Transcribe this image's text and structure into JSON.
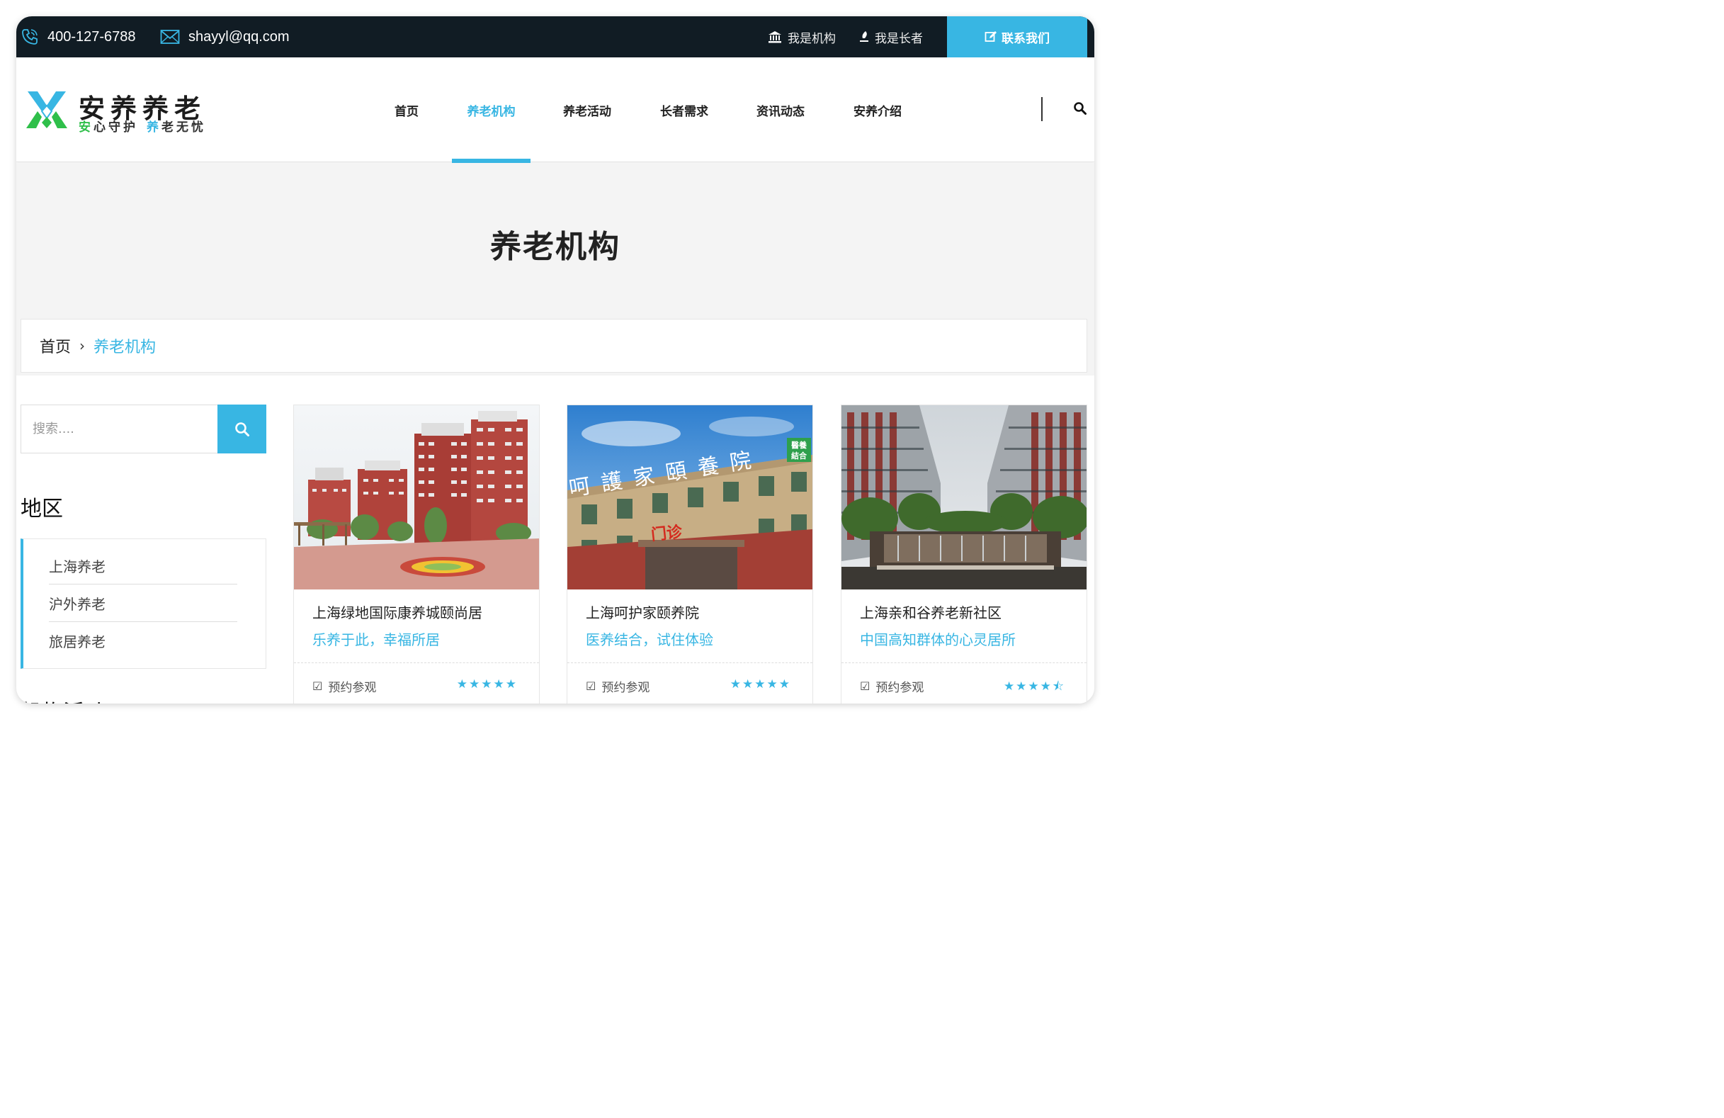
{
  "topbar": {
    "phone": "400-127-6788",
    "email": "shayyl@qq.com",
    "links": [
      {
        "icon": "institution-icon",
        "label": "我是机构"
      },
      {
        "icon": "pin-icon",
        "label": "我是长者"
      }
    ],
    "contact": {
      "icon": "edit-icon",
      "label": "联系我们"
    }
  },
  "logo": {
    "title": "安养养老",
    "tagline_1_green": "安",
    "tagline_1_rest": "心守护",
    "tagline_2_blue": "养",
    "tagline_2_rest": "老无忧"
  },
  "nav": {
    "items": [
      "首页",
      "养老机构",
      "养老活动",
      "长者需求",
      "资讯动态",
      "安养介绍"
    ],
    "active": "养老机构"
  },
  "page": {
    "title": "养老机构"
  },
  "breadcrumb": {
    "home": "首页",
    "separator": "›",
    "current": "养老机构"
  },
  "sidebar": {
    "search_placeholder": "搜索....",
    "region_title": "地区",
    "regions": [
      "上海养老",
      "沪外养老",
      "旅居养老"
    ],
    "next_title": "机构活动"
  },
  "cards": [
    {
      "name": "上海绿地国际康养城颐尚居",
      "tagline": "乐养于此，幸福所居",
      "action": "预约参观",
      "rating": 5,
      "stars": "★★★★★"
    },
    {
      "name": "上海呵护家颐养院",
      "tagline": "医养结合，试住体验",
      "action": "预约参观",
      "rating": 5,
      "stars": "★★★★★"
    },
    {
      "name": "上海亲和谷养老新社区",
      "tagline": "中国高知群体的心灵居所",
      "action": "预约参观",
      "rating": 4.5,
      "stars": "★★★★⯪"
    }
  ],
  "image_text": {
    "card2_sign": "呵護家頤養院",
    "card2_badge": "醫養結合",
    "card2_door": "门诊"
  },
  "colors": {
    "accent": "#38b6e3",
    "topbar": "#111c24",
    "logo_green": "#2fbf4a"
  }
}
